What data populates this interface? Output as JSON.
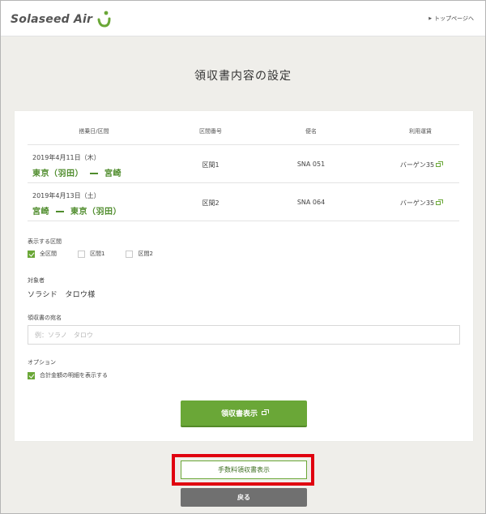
{
  "header": {
    "logo_text": "Solaseed Air",
    "top_link": "トップページへ"
  },
  "page_title": "領収書内容の設定",
  "table": {
    "headers": [
      "搭乗日/区間",
      "区間番号",
      "便名",
      "利用運賃"
    ],
    "rows": [
      {
        "date": "2019年4月11日（木）",
        "origin": "東京（羽田）",
        "destination": "宮崎",
        "segment": "区間1",
        "flight": "SNA 051",
        "fare": "バーゲン35"
      },
      {
        "date": "2019年4月13日（土）",
        "origin": "宮崎",
        "destination": "東京（羽田）",
        "segment": "区間2",
        "flight": "SNA 064",
        "fare": "バーゲン35"
      }
    ]
  },
  "display_section": {
    "label": "表示する区間",
    "options": [
      {
        "label": "全区間",
        "checked": true
      },
      {
        "label": "区間1",
        "checked": false
      },
      {
        "label": "区間2",
        "checked": false
      }
    ]
  },
  "target": {
    "label": "対象者",
    "name": "ソラシド　タロウ様"
  },
  "address": {
    "label": "領収書の宛名",
    "value": "",
    "placeholder": "例：ソラノ　タロウ"
  },
  "option": {
    "label": "オプション",
    "checkbox_label": "合計金額の明細を表示する",
    "checked": true
  },
  "buttons": {
    "receipt": "領収書表示",
    "fee_receipt": "手数料領収書表示",
    "back": "戻る"
  },
  "colors": {
    "accent": "#6aa737",
    "route_text": "#4f8c2c",
    "highlight": "#e0000f",
    "back_button": "#707070",
    "background": "#efeeea"
  }
}
